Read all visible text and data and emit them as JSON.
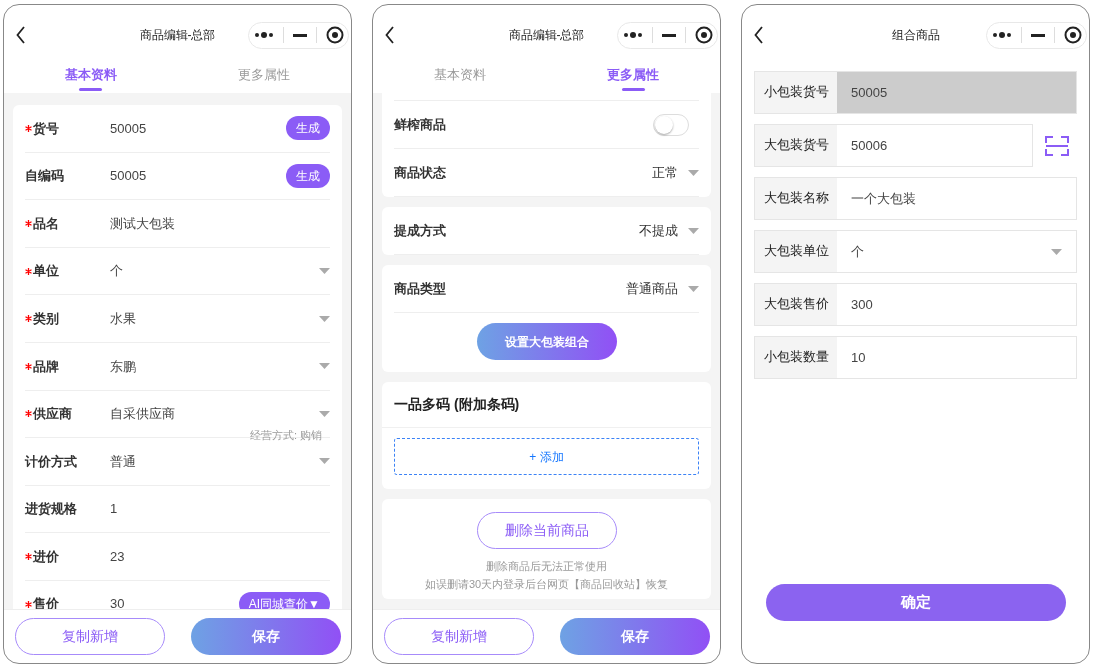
{
  "screens": [
    {
      "kind": "basic",
      "title": "商品编辑-总部",
      "tabs": [
        {
          "label": "基本资料",
          "selected": true
        },
        {
          "label": "更多属性",
          "selected": false
        }
      ],
      "fields": [
        {
          "label": "货号",
          "required": true,
          "value": "50005",
          "kind": "button",
          "action": "生成"
        },
        {
          "label": "自编码",
          "required": false,
          "value": "50005",
          "kind": "button",
          "action": "生成"
        },
        {
          "label": "品名",
          "required": true,
          "value": "测试大包装",
          "kind": "text"
        },
        {
          "label": "单位",
          "required": true,
          "value": "个",
          "kind": "select"
        },
        {
          "label": "类别",
          "required": true,
          "value": "水果",
          "kind": "select"
        },
        {
          "label": "品牌",
          "required": true,
          "value": "东鹏",
          "kind": "select"
        },
        {
          "label": "供应商",
          "required": true,
          "value": "自采供应商",
          "kind": "select",
          "note": "经营方式: 购销"
        },
        {
          "label": "计价方式",
          "required": false,
          "value": "普通",
          "kind": "select"
        },
        {
          "label": "进货规格",
          "required": false,
          "value": "1",
          "kind": "text"
        },
        {
          "label": "进价",
          "required": true,
          "value": "23",
          "kind": "text"
        },
        {
          "label": "售价",
          "required": true,
          "value": "30",
          "kind": "button",
          "action": "AI同城查价▼"
        }
      ],
      "footer": {
        "secondary": "复制新增",
        "primary": "保存"
      }
    },
    {
      "kind": "more",
      "title": "商品编辑-总部",
      "tabs": [
        {
          "label": "基本资料",
          "selected": false
        },
        {
          "label": "更多属性",
          "selected": true
        }
      ],
      "cards": [
        {
          "rows": [
            {
              "kind": "toggle",
              "label": "鲜榨商品",
              "on": false
            },
            {
              "kind": "select",
              "label": "商品状态",
              "value": "正常"
            }
          ],
          "top_cut": true
        },
        {
          "rows": [
            {
              "kind": "select",
              "label": "提成方式",
              "value": "不提成"
            }
          ]
        },
        {
          "rows": [
            {
              "kind": "select",
              "label": "商品类型",
              "value": "普通商品"
            }
          ],
          "button": "设置大包装组合"
        },
        {
          "heading": "一品多码 (附加条码)",
          "add": "+ 添加"
        },
        {
          "delete": "删除当前商品",
          "notes": [
            "删除商品后无法正常使用",
            "如误删请30天内登录后台网页【商品回收站】恢复"
          ]
        }
      ],
      "footer": {
        "secondary": "复制新增",
        "primary": "保存"
      }
    },
    {
      "kind": "combo",
      "title": "组合商品",
      "rows": [
        {
          "label": "小包装货号",
          "value": "50005",
          "kind": "readonly"
        },
        {
          "label": "大包装货号",
          "value": "50006",
          "kind": "scan"
        },
        {
          "label": "大包装名称",
          "value": "一个大包装",
          "kind": "text"
        },
        {
          "label": "大包装单位",
          "value": "个",
          "kind": "select"
        },
        {
          "label": "大包装售价",
          "value": "300",
          "kind": "text"
        },
        {
          "label": "小包装数量",
          "value": "10",
          "kind": "text"
        }
      ],
      "confirm": "确定"
    }
  ]
}
